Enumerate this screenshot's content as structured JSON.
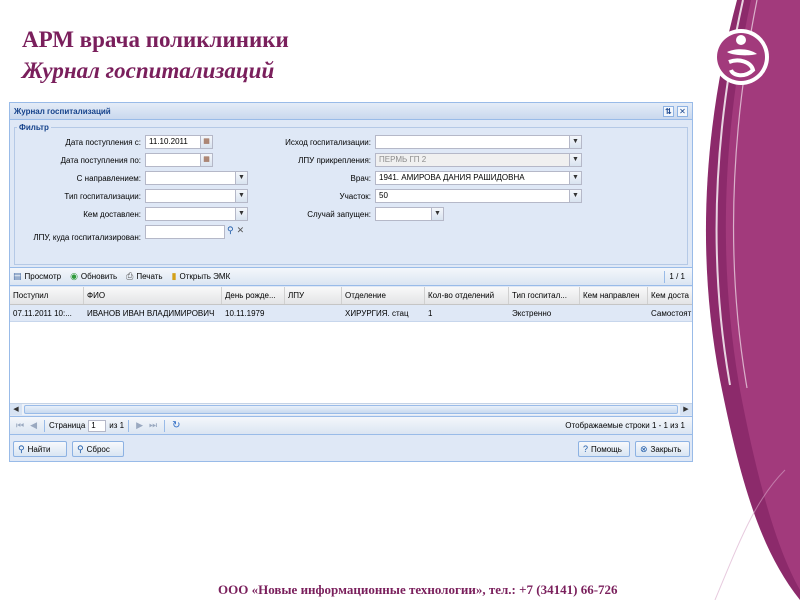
{
  "slide": {
    "title_line1": "АРМ врача поликлиники",
    "title_line2": "Журнал госпитализаций",
    "footer": "ООО «Новые информационные технологии», тел.: +7 (34141) 66-726"
  },
  "window": {
    "title": "Журнал госпитализаций",
    "tools": [
      "⇅",
      "✕"
    ]
  },
  "filter": {
    "legend": "Фильтр",
    "left": [
      {
        "label": "Дата поступления с:",
        "value": "11.10.2011"
      },
      {
        "label": "Дата поступления по:",
        "value": ""
      },
      {
        "label": "С направлением:",
        "value": ""
      },
      {
        "label": "Тип госпитализации:",
        "value": ""
      },
      {
        "label": "Кем доставлен:",
        "value": ""
      },
      {
        "label": "ЛПУ, куда госпитализирован:",
        "value": ""
      }
    ],
    "right": [
      {
        "label": "Исход госпитализации:",
        "value": ""
      },
      {
        "label": "ЛПУ прикрепления:",
        "value": "ПЕРМЬ ГП 2"
      },
      {
        "label": "Врач:",
        "value": "1941. АМИРОВА ДАНИЯ РАШИДОВНА"
      },
      {
        "label": "Участок:",
        "value": "50"
      },
      {
        "label": "Случай запущен:",
        "value": ""
      }
    ]
  },
  "toolbar": {
    "view": "Просмотр",
    "refresh": "Обновить",
    "print": "Печать",
    "open_emk": "Открыть ЭМК",
    "page_counter": "1 / 1"
  },
  "grid": {
    "columns": [
      "Поступил",
      "ФИО",
      "День рожде...",
      "ЛПУ",
      "Отделение",
      "Кол-во отделений",
      "Тип госпитал...",
      "Кем направлен",
      "Кем доста"
    ],
    "rows": [
      [
        "07.11.2011 10:...",
        "ИВАНОВ ИВАН ВЛАДИМИРОВИЧ",
        "10.11.1979",
        "",
        "ХИРУРГИЯ. стац",
        "1",
        "Экстренно",
        "",
        "Самостоят"
      ]
    ]
  },
  "pager": {
    "page_label": "Страница",
    "page_value": "1",
    "of_label": "из 1",
    "status": "Отображаемые строки 1 - 1 из 1"
  },
  "buttons": {
    "find": "Найти",
    "reset": "Сброс",
    "help": "Помощь",
    "close": "Закрыть"
  },
  "colors": {
    "brand": "#7a1f5c",
    "window_bg": "#dfe8f6",
    "border": "#99bbe8"
  }
}
